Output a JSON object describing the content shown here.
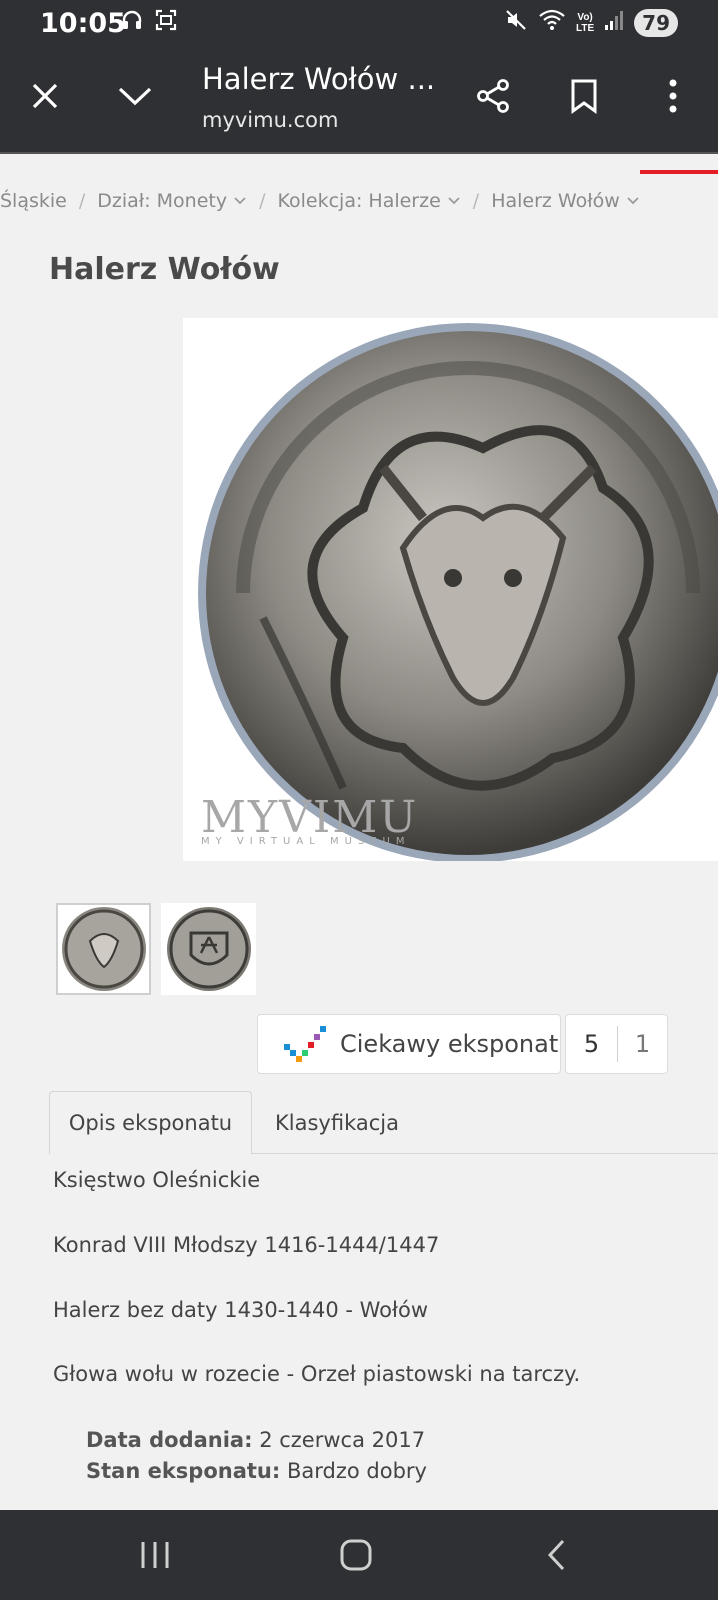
{
  "status": {
    "time": "10:05",
    "battery": "79"
  },
  "toolbar": {
    "title": "Halerz Wołów ...",
    "url": "myvimu.com"
  },
  "breadcrumb": [
    {
      "label": "Śląskie",
      "dropdown": false
    },
    {
      "label": "Dział: Monety",
      "dropdown": true
    },
    {
      "label": "Kolekcja: Halerze",
      "dropdown": true
    },
    {
      "label": "Halerz Wołów",
      "dropdown": true
    }
  ],
  "page": {
    "title": "Halerz Wołów"
  },
  "image": {
    "watermark": "MYVIMU",
    "watermark_sub": "MY VIRTUAL MUSEUM"
  },
  "like": {
    "label": "Ciekawy eksponat",
    "count_likes": "5",
    "count_other": "1"
  },
  "tabs": [
    {
      "label": "Opis eksponatu",
      "active": true
    },
    {
      "label": "Klasyfikacja",
      "active": false
    }
  ],
  "description": [
    "Księstwo Oleśnickie",
    "Konrad VIII Młodszy 1416-1444/1447",
    "Halerz bez daty 1430-1440 - Wołów",
    "Głowa wołu w rozecie - Orzeł piastowski na tarczy."
  ],
  "meta": {
    "added_label": "Data dodania:",
    "added_value": "2 czerwca 2017",
    "state_label": "Stan eksponatu:",
    "state_value": "Bardzo dobry"
  },
  "colors": {
    "toolbar": "#2f3033",
    "accent": "#e31e24",
    "background": "#f1f1f1"
  }
}
